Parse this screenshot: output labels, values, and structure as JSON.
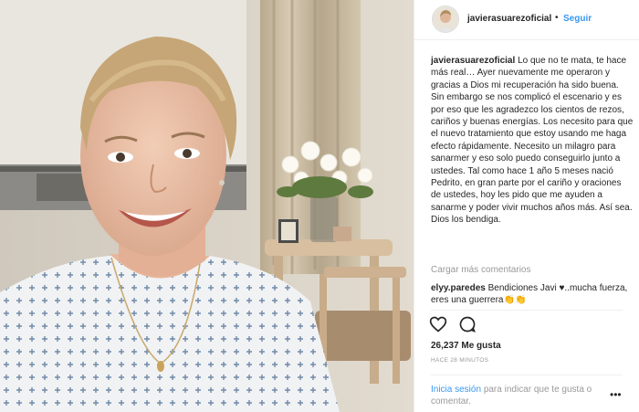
{
  "post": {
    "username": "javierasuarezoficial",
    "separator": "•",
    "follow_label": "Seguir",
    "caption_username": "javierasuarezoficial",
    "caption_text": "Lo que no te mata, te hace más real… Ayer nuevamente me operaron y gracias a Dios mi recuperación ha sido buena. Sin embargo se nos complicó el escenario y es por eso que les agradezco los cientos de rezos, cariños y buenas energías. Los necesito para que el nuevo tratamiento que estoy usando me haga efecto rápidamente. Necesito un milagro para sanarmer y eso solo puedo conseguirlo junto a ustedes. Tal como hace 1 año 5 meses nació Pedrito, en gran parte por el cariño y oraciones de ustedes, hoy les pido que me ayuden a sanarme y poder vivir muchos años más. Así sea. Dios los bendiga.",
    "load_more_label": "Cargar más comentarios",
    "comment_username": "elyy.paredes",
    "comment_text": "Bendiciones Javi ♥..mucha fuerza, eres una guerrera👏👏",
    "likes_label": "26,237 Me gusta",
    "time_label": "HACE 28 MINUTOS",
    "login_link": "Inicia sesión",
    "login_text": "para indicar que te gusta o comentar.",
    "options_label": "•••"
  },
  "icons": {
    "like": "heart-outline-icon",
    "comment": "speech-bubble-icon"
  },
  "colors": {
    "link_blue": "#3897f0",
    "text": "#262626",
    "muted": "#999999"
  }
}
